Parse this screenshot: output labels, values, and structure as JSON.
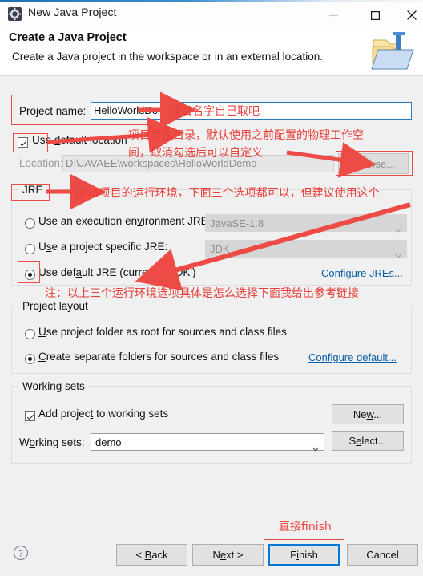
{
  "window": {
    "title": "New Java Project",
    "icon": "eclipse-gear-icon",
    "minimize": "minimize-icon",
    "maximize": "maximize-icon",
    "close": "close-icon"
  },
  "header": {
    "title": "Create a Java Project",
    "subtitle": "Create a Java project in the workspace or in an external location.",
    "icon": "java-project-folder-icon"
  },
  "project": {
    "name_label": "Project name:",
    "name_label_pre": "P",
    "name_label_post": "roject name:",
    "name_value": "HelloWorldDemo",
    "use_default_location_label_pre": "Use ",
    "use_default_location_label_key": "d",
    "use_default_location_label_post": "efault location",
    "use_default_location_checked": true,
    "location_label_key": "L",
    "location_label_post": "ocation:",
    "location_value": "D:\\JAVAEE\\workspaces\\HelloWorldDemo",
    "browse_label_pre": "B",
    "browse_label_key": "r",
    "browse_label_post": "owse...",
    "browse_enabled": false
  },
  "jre": {
    "group_title": "JRE",
    "option_env_pre": "Use an execution en",
    "option_env_key": "v",
    "option_env_post": "ironment JRE:",
    "option_env_value": "JavaSE-1.8",
    "option_env_selected": false,
    "option_specific_pre": "U",
    "option_specific_key": "s",
    "option_specific_post": "e a project specific JRE:",
    "option_specific_value": "JDK",
    "option_specific_selected": false,
    "option_default_pre": "Use def",
    "option_default_key": "a",
    "option_default_post": "ult JRE (currently 'JDK')",
    "option_default_selected": true,
    "configure_link": "Configure JREs..."
  },
  "layout": {
    "group_title": "Project layout",
    "option_root_pre": "",
    "option_root_key": "U",
    "option_root_post": "se project folder as root for sources and class files",
    "option_root_selected": false,
    "option_separate_pre": "",
    "option_separate_key": "C",
    "option_separate_post": "reate separate folders for sources and class files",
    "option_separate_selected": true,
    "configure_link": "Configure default..."
  },
  "working_sets": {
    "group_title": "Working sets",
    "add_label_pre": "Add projec",
    "add_label_key": "t",
    "add_label_post": " to working sets",
    "add_checked": true,
    "sets_label_pre": "W",
    "sets_label_key": "o",
    "sets_label_post": "rking sets:",
    "sets_value": "demo",
    "new_label_pre": "Ne",
    "new_label_key": "w",
    "new_label_post": "...",
    "select_label_pre": "S",
    "select_label_key": "e",
    "select_label_post": "lect..."
  },
  "footer": {
    "help": "help-icon",
    "back_pre": "< ",
    "back_key": "B",
    "back_post": "ack",
    "next_pre": "N",
    "next_key": "e",
    "next_post": "xt >",
    "finish_pre": "F",
    "finish_key": "i",
    "finish_post": "nish",
    "cancel": "Cancel"
  },
  "annotations": {
    "project_name": "项目名字自己取吧",
    "location_line1": "项目存放目录，默认使用之前配置的物理工作空",
    "location_line2": "间，取消勾选后可以自定义",
    "jre_note": "Java项目的运行环境，下面三个选项都可以，但建议使用这个",
    "jre_footnote": "注：以上三个运行环境选项具体是怎么选择下面我给出参考链接",
    "finish": "直接finish"
  },
  "colors": {
    "annotation_red": "#e8403a",
    "box_red": "#ec4b46",
    "link_blue": "#0a5ea8",
    "focus_blue": "#2a7ac0",
    "default_button_blue": "#0078d7"
  }
}
